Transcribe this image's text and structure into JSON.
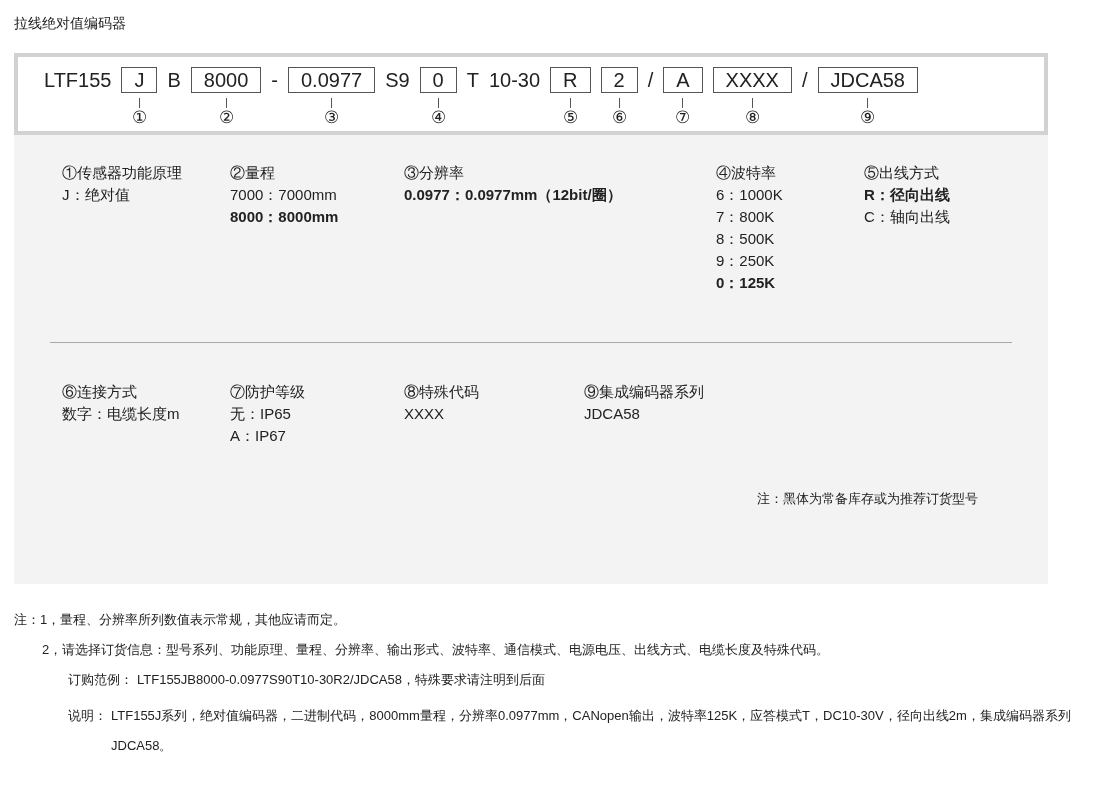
{
  "title": "拉线绝对值编码器",
  "model_code": [
    {
      "kind": "text",
      "text": "LTF155"
    },
    {
      "kind": "box",
      "text": "J",
      "marker": "①"
    },
    {
      "kind": "text",
      "text": "B"
    },
    {
      "kind": "box",
      "text": "8000",
      "marker": "②"
    },
    {
      "kind": "text",
      "text": "-"
    },
    {
      "kind": "box",
      "text": "0.0977",
      "marker": "③"
    },
    {
      "kind": "text",
      "text": "S9"
    },
    {
      "kind": "box",
      "text": "0",
      "marker": "④"
    },
    {
      "kind": "text",
      "text": "T"
    },
    {
      "kind": "text",
      "text": "10-30"
    },
    {
      "kind": "box",
      "text": "R",
      "marker": "⑤"
    },
    {
      "kind": "box",
      "text": "2",
      "marker": "⑥"
    },
    {
      "kind": "text",
      "text": "/"
    },
    {
      "kind": "box",
      "text": "A",
      "marker": "⑦"
    },
    {
      "kind": "box",
      "text": "XXXX",
      "marker": "⑧"
    },
    {
      "kind": "text",
      "text": "/"
    },
    {
      "kind": "box",
      "text": "JDCA58",
      "marker": "⑨"
    }
  ],
  "spec_rows": [
    {
      "groups": [
        {
          "heading": "①传感器功能原理",
          "options": [
            {
              "text": "J：绝对值",
              "recommended": false
            }
          ]
        },
        {
          "heading": "②量程",
          "options": [
            {
              "text": "7000：7000mm",
              "recommended": false
            },
            {
              "text": "8000：8000mm",
              "recommended": true
            }
          ]
        },
        {
          "heading": "③分辨率",
          "options": [
            {
              "text": "0.0977：0.0977mm（12bit/圈）",
              "recommended": true
            }
          ]
        },
        {
          "heading": "④波特率",
          "options": [
            {
              "text": "6：1000K",
              "recommended": false
            },
            {
              "text": "7：800K",
              "recommended": false
            },
            {
              "text": "8：500K",
              "recommended": false
            },
            {
              "text": "9：250K",
              "recommended": false
            },
            {
              "text": "0：125K",
              "recommended": true
            }
          ]
        },
        {
          "heading": "⑤出线方式",
          "options": [
            {
              "text": "R：径向出线",
              "recommended": true
            },
            {
              "text": "C：轴向出线",
              "recommended": false
            }
          ]
        }
      ]
    },
    {
      "groups": [
        {
          "heading": "⑥连接方式",
          "options": [
            {
              "text": "数字：电缆长度m",
              "recommended": false
            }
          ]
        },
        {
          "heading": "⑦防护等级",
          "options": [
            {
              "text": "无：IP65",
              "recommended": false
            },
            {
              "text": "A：IP67",
              "recommended": false
            }
          ]
        },
        {
          "heading": "⑧特殊代码",
          "options": [
            {
              "text": "XXXX",
              "recommended": false
            }
          ]
        },
        {
          "heading": "⑨集成编码器系列",
          "options": [
            {
              "text": "JDCA58",
              "recommended": false
            }
          ]
        }
      ]
    }
  ],
  "legend": "注：黑体为常备库存或为推荐订货型号",
  "notes": [
    {
      "kind": "note1",
      "text": "注：1，量程、分辨率所列数值表示常规，其他应请而定。"
    },
    {
      "kind": "note2",
      "text": "2，请选择订货信息：型号系列、功能原理、量程、分辨率、输出形式、波特率、通信模式、电源电压、出线方式、电缆长度及特殊代码。"
    },
    {
      "kind": "labeled",
      "label": "订购范例：",
      "text": "LTF155JB8000-0.0977S90T10-30R2/JDCA58，特殊要求请注明到后面"
    },
    {
      "kind": "labeled",
      "label": "说明：",
      "text": "LTF155J系列，绝对值编码器，二进制代码，8000mm量程，分辨率0.0977mm，CANopen输出，波特率125K，应答模式T，DC10-30V，径向出线2m，集成编码器系列JDCA58。"
    }
  ]
}
